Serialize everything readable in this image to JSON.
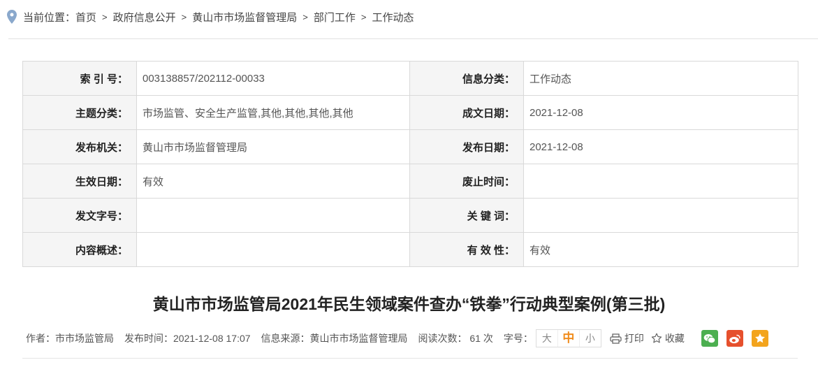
{
  "breadcrumb": {
    "prefix": "当前位置：",
    "items": [
      "首页",
      "政府信息公开",
      "黄山市市场监督管理局",
      "部门工作",
      "工作动态"
    ],
    "separator": ">"
  },
  "info_table": {
    "rows": [
      {
        "label_left": "索 引 号：",
        "value_left": "003138857/202112-00033",
        "label_right": "信息分类：",
        "value_right": "工作动态"
      },
      {
        "label_left": "主题分类：",
        "value_left": "市场监管、安全生产监管,其他,其他,其他,其他",
        "label_right": "成文日期：",
        "value_right": "2021-12-08"
      },
      {
        "label_left": "发布机关：",
        "value_left": "黄山市市场监督管理局",
        "label_right": "发布日期：",
        "value_right": "2021-12-08"
      },
      {
        "label_left": "生效日期：",
        "value_left": "有效",
        "label_right": "废止时间：",
        "value_right": ""
      },
      {
        "label_left": "发文字号：",
        "value_left": "",
        "label_right": "关 键 词：",
        "value_right": ""
      },
      {
        "label_left": "内容概述：",
        "value_left": "",
        "label_right": "有 效 性：",
        "value_right": "有效"
      }
    ]
  },
  "article": {
    "title": "黄山市市场监管局2021年民生领域案件查办“铁拳”行动典型案例(第三批)"
  },
  "meta": {
    "author": "作者：市市场监管局",
    "publish_time": "发布时间：2021-12-08 17:07",
    "source": "信息来源：黄山市市场监督管理局",
    "read_count": "阅读次数： 61 次",
    "font_size_label": "字号：",
    "font_sizes": [
      "大",
      "中",
      "小"
    ],
    "print_label": "打印",
    "favorite_label": "收藏"
  },
  "colors": {
    "wechat": "#4caf50",
    "weibo": "#e6502d",
    "qzone": "#f3a41d",
    "accent_font_active": "#f08c1c",
    "pin": "#8aa8cc"
  }
}
